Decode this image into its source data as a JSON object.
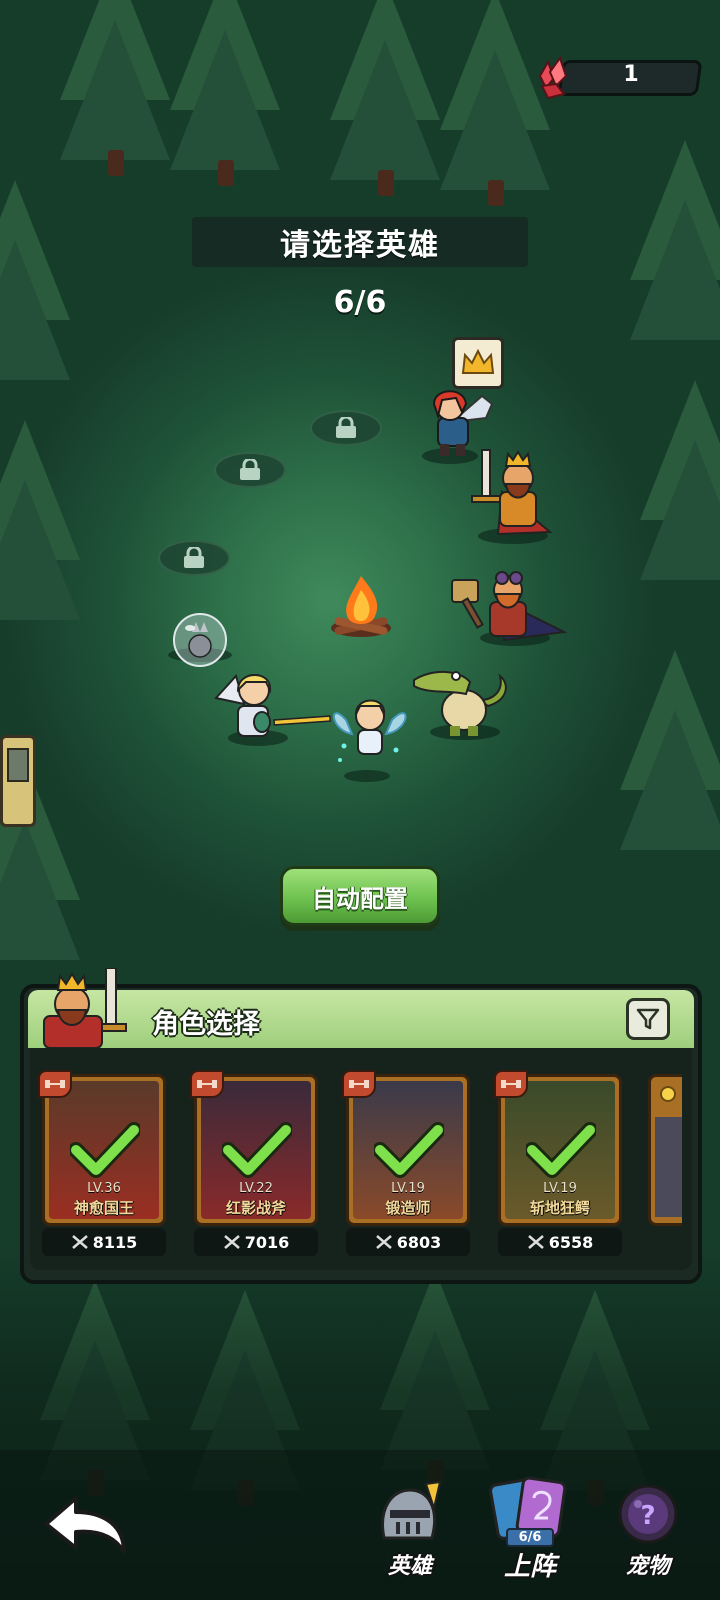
{
  "currency": {
    "icon": "red-crystal-icon",
    "count": "1"
  },
  "title": "请选择英雄",
  "slots": {
    "filled": "6/6"
  },
  "auto_button": "自动配置",
  "panel": {
    "title": "角色选择",
    "filter_icon": "filter-icon",
    "cards": [
      {
        "level": "LV.36",
        "name": "神愈国王",
        "power": "8115",
        "selected": true,
        "class_icon": "dumbbell-icon"
      },
      {
        "level": "LV.22",
        "name": "红影战斧",
        "power": "7016",
        "selected": true,
        "class_icon": "dumbbell-icon"
      },
      {
        "level": "LV.19",
        "name": "锻造师",
        "power": "6803",
        "selected": true,
        "class_icon": "dumbbell-icon"
      },
      {
        "level": "LV.19",
        "name": "斩地狂鳄",
        "power": "6558",
        "selected": true,
        "class_icon": "dumbbell-icon"
      }
    ]
  },
  "nav": {
    "back_icon": "back-arrow-icon",
    "heroes": "英雄",
    "lineup": "上阵",
    "lineup_count": "6/6",
    "pets": "宠物"
  },
  "colors": {
    "accent_green": "#6ec24f",
    "panel_header": "#c6e6a3",
    "card_frame": "#a86f25"
  }
}
